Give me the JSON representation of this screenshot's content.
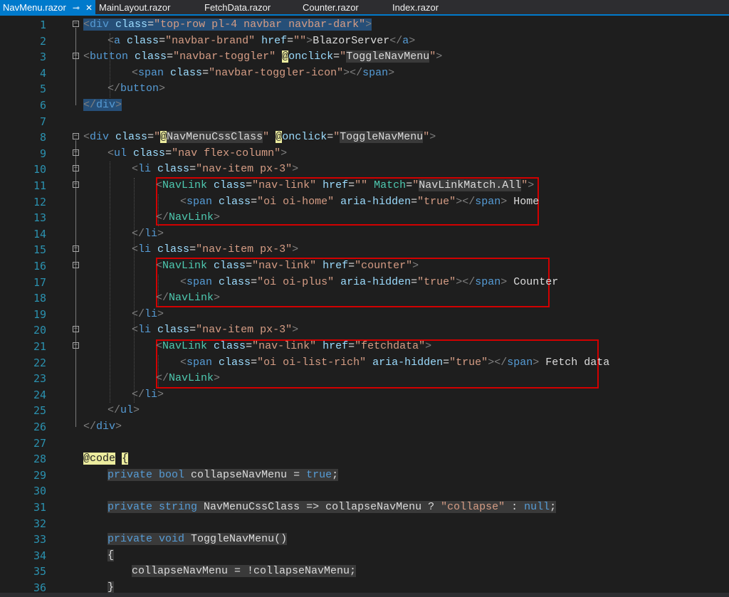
{
  "tabs": [
    {
      "label": "NavMenu.razor",
      "active": true,
      "pin": "⊸",
      "close": "✕"
    },
    {
      "label": "MainLayout.razor",
      "active": false
    },
    {
      "label": "FetchData.razor",
      "active": false
    },
    {
      "label": "Counter.razor",
      "active": false
    },
    {
      "label": "Index.razor",
      "active": false
    }
  ],
  "colors": {
    "accent": "#007acc",
    "highlight_box": "#d20000",
    "selection": "#264f78"
  },
  "lines": [
    {
      "n": "1",
      "fold": "minus",
      "tokens": [
        [
          "sel t-tag",
          "<"
        ],
        [
          "sel t-name",
          "div"
        ],
        [
          "sel t-text",
          " "
        ],
        [
          "sel t-attr",
          "class"
        ],
        [
          "sel t-text",
          "="
        ],
        [
          "sel t-val",
          "\"top-row pl-4 navbar navbar-dark\""
        ],
        [
          "sel t-tag",
          ">"
        ]
      ]
    },
    {
      "n": "2",
      "tokens": [
        [
          "t-tag",
          "<"
        ],
        [
          "t-name",
          "a"
        ],
        [
          "t-text",
          " "
        ],
        [
          "t-attr",
          "class"
        ],
        [
          "t-text",
          "="
        ],
        [
          "t-val",
          "\"navbar-brand\""
        ],
        [
          "t-text",
          " "
        ],
        [
          "t-attr",
          "href"
        ],
        [
          "t-text",
          "="
        ],
        [
          "t-val",
          "\"\""
        ],
        [
          "t-tag",
          ">"
        ],
        [
          "t-text",
          "BlazorServer"
        ],
        [
          "t-tag",
          "</"
        ],
        [
          "t-name",
          "a"
        ],
        [
          "t-tag",
          ">"
        ]
      ]
    },
    {
      "n": "3",
      "fold": "minus",
      "tokens": [
        [
          "t-tag",
          "<"
        ],
        [
          "t-name",
          "button"
        ],
        [
          "t-text",
          " "
        ],
        [
          "t-attr",
          "class"
        ],
        [
          "t-text",
          "="
        ],
        [
          "t-val",
          "\"navbar-toggler\""
        ],
        [
          "t-text",
          " "
        ],
        [
          "t-razor",
          "@"
        ],
        [
          "t-attr",
          "onclick"
        ],
        [
          "t-text",
          "="
        ],
        [
          "t-val",
          "\""
        ],
        [
          "hl-ws t-plain",
          "ToggleNavMenu"
        ],
        [
          "t-val",
          "\""
        ],
        [
          "t-tag",
          ">"
        ]
      ]
    },
    {
      "n": "4",
      "tokens": [
        [
          "t-tag",
          "<"
        ],
        [
          "t-name",
          "span"
        ],
        [
          "t-text",
          " "
        ],
        [
          "t-attr",
          "class"
        ],
        [
          "t-text",
          "="
        ],
        [
          "t-val",
          "\"navbar-toggler-icon\""
        ],
        [
          "t-tag",
          "></"
        ],
        [
          "t-name",
          "span"
        ],
        [
          "t-tag",
          ">"
        ]
      ]
    },
    {
      "n": "5",
      "tokens": [
        [
          "t-tag",
          "</"
        ],
        [
          "t-name",
          "button"
        ],
        [
          "t-tag",
          ">"
        ]
      ]
    },
    {
      "n": "6",
      "tokens": [
        [
          "sel t-tag",
          "</"
        ],
        [
          "sel t-name",
          "div"
        ],
        [
          "sel t-tag",
          ">"
        ]
      ]
    },
    {
      "n": "7",
      "tokens": []
    },
    {
      "n": "8",
      "fold": "minus",
      "tokens": [
        [
          "t-tag",
          "<"
        ],
        [
          "t-name",
          "div"
        ],
        [
          "t-text",
          " "
        ],
        [
          "t-attr",
          "class"
        ],
        [
          "t-text",
          "="
        ],
        [
          "t-val",
          "\""
        ],
        [
          "t-razor",
          "@"
        ],
        [
          "hl-ws t-plain",
          "NavMenuCssClass"
        ],
        [
          "t-val",
          "\""
        ],
        [
          "t-text",
          " "
        ],
        [
          "t-razor",
          "@"
        ],
        [
          "t-attr",
          "onclick"
        ],
        [
          "t-text",
          "="
        ],
        [
          "t-val",
          "\""
        ],
        [
          "hl-ws t-plain",
          "ToggleNavMenu"
        ],
        [
          "t-val",
          "\""
        ],
        [
          "t-tag",
          ">"
        ]
      ]
    },
    {
      "n": "9",
      "fold": "minus",
      "tokens": [
        [
          "t-tag",
          "<"
        ],
        [
          "t-name",
          "ul"
        ],
        [
          "t-text",
          " "
        ],
        [
          "t-attr",
          "class"
        ],
        [
          "t-text",
          "="
        ],
        [
          "t-val",
          "\"nav flex-column\""
        ],
        [
          "t-tag",
          ">"
        ]
      ]
    },
    {
      "n": "10",
      "fold": "minus",
      "tokens": [
        [
          "t-tag",
          "<"
        ],
        [
          "t-name",
          "li"
        ],
        [
          "t-text",
          " "
        ],
        [
          "t-attr",
          "class"
        ],
        [
          "t-text",
          "="
        ],
        [
          "t-val",
          "\"nav-item px-3\""
        ],
        [
          "t-tag",
          ">"
        ]
      ]
    },
    {
      "n": "11",
      "fold": "minus",
      "tokens": [
        [
          "t-tag",
          "<"
        ],
        [
          "t-comp",
          "NavLink"
        ],
        [
          "t-text",
          " "
        ],
        [
          "t-attr",
          "class"
        ],
        [
          "t-text",
          "="
        ],
        [
          "t-val",
          "\"nav-link\""
        ],
        [
          "t-text",
          " "
        ],
        [
          "t-attr",
          "href"
        ],
        [
          "t-text",
          "="
        ],
        [
          "t-val",
          "\"\""
        ],
        [
          "t-text",
          " "
        ],
        [
          "t-comp",
          "Match"
        ],
        [
          "t-text",
          "="
        ],
        [
          "t-val",
          "\""
        ],
        [
          "hl-ws t-plain",
          "NavLinkMatch.All"
        ],
        [
          "t-val",
          "\""
        ],
        [
          "t-tag",
          ">"
        ]
      ]
    },
    {
      "n": "12",
      "tokens": [
        [
          "t-tag",
          "<"
        ],
        [
          "t-name",
          "span"
        ],
        [
          "t-text",
          " "
        ],
        [
          "t-attr",
          "class"
        ],
        [
          "t-text",
          "="
        ],
        [
          "t-val",
          "\"oi oi-home\""
        ],
        [
          "t-text",
          " "
        ],
        [
          "t-attr",
          "aria-hidden"
        ],
        [
          "t-text",
          "="
        ],
        [
          "t-val",
          "\"true\""
        ],
        [
          "t-tag",
          "></"
        ],
        [
          "t-name",
          "span"
        ],
        [
          "t-tag",
          ">"
        ],
        [
          "t-text",
          " Home"
        ]
      ]
    },
    {
      "n": "13",
      "tokens": [
        [
          "t-tag",
          "</"
        ],
        [
          "t-comp",
          "NavLink"
        ],
        [
          "t-tag",
          ">"
        ]
      ]
    },
    {
      "n": "14",
      "tokens": [
        [
          "t-tag",
          "</"
        ],
        [
          "t-name",
          "li"
        ],
        [
          "t-tag",
          ">"
        ]
      ]
    },
    {
      "n": "15",
      "fold": "minus",
      "tokens": [
        [
          "t-tag",
          "<"
        ],
        [
          "t-name",
          "li"
        ],
        [
          "t-text",
          " "
        ],
        [
          "t-attr",
          "class"
        ],
        [
          "t-text",
          "="
        ],
        [
          "t-val",
          "\"nav-item px-3\""
        ],
        [
          "t-tag",
          ">"
        ]
      ]
    },
    {
      "n": "16",
      "fold": "minus",
      "tokens": [
        [
          "t-tag",
          "<"
        ],
        [
          "t-comp",
          "NavLink"
        ],
        [
          "t-text",
          " "
        ],
        [
          "t-attr",
          "class"
        ],
        [
          "t-text",
          "="
        ],
        [
          "t-val",
          "\"nav-link\""
        ],
        [
          "t-text",
          " "
        ],
        [
          "t-attr",
          "href"
        ],
        [
          "t-text",
          "="
        ],
        [
          "t-val",
          "\"counter\""
        ],
        [
          "t-tag",
          ">"
        ]
      ]
    },
    {
      "n": "17",
      "tokens": [
        [
          "t-tag",
          "<"
        ],
        [
          "t-name",
          "span"
        ],
        [
          "t-text",
          " "
        ],
        [
          "t-attr",
          "class"
        ],
        [
          "t-text",
          "="
        ],
        [
          "t-val",
          "\"oi oi-plus\""
        ],
        [
          "t-text",
          " "
        ],
        [
          "t-attr",
          "aria-hidden"
        ],
        [
          "t-text",
          "="
        ],
        [
          "t-val",
          "\"true\""
        ],
        [
          "t-tag",
          "></"
        ],
        [
          "t-name",
          "span"
        ],
        [
          "t-tag",
          ">"
        ],
        [
          "t-text",
          " Counter"
        ]
      ]
    },
    {
      "n": "18",
      "tokens": [
        [
          "t-tag",
          "</"
        ],
        [
          "t-comp",
          "NavLink"
        ],
        [
          "t-tag",
          ">"
        ]
      ]
    },
    {
      "n": "19",
      "tokens": [
        [
          "t-tag",
          "</"
        ],
        [
          "t-name",
          "li"
        ],
        [
          "t-tag",
          ">"
        ]
      ]
    },
    {
      "n": "20",
      "fold": "minus",
      "tokens": [
        [
          "t-tag",
          "<"
        ],
        [
          "t-name",
          "li"
        ],
        [
          "t-text",
          " "
        ],
        [
          "t-attr",
          "class"
        ],
        [
          "t-text",
          "="
        ],
        [
          "t-val",
          "\"nav-item px-3\""
        ],
        [
          "t-tag",
          ">"
        ]
      ]
    },
    {
      "n": "21",
      "fold": "minus",
      "tokens": [
        [
          "t-tag",
          "<"
        ],
        [
          "t-comp",
          "NavLink"
        ],
        [
          "t-text",
          " "
        ],
        [
          "t-attr",
          "class"
        ],
        [
          "t-text",
          "="
        ],
        [
          "t-val",
          "\"nav-link\""
        ],
        [
          "t-text",
          " "
        ],
        [
          "t-attr",
          "href"
        ],
        [
          "t-text",
          "="
        ],
        [
          "t-val",
          "\"fetchdata\""
        ],
        [
          "t-tag",
          ">"
        ]
      ]
    },
    {
      "n": "22",
      "tokens": [
        [
          "t-tag",
          "<"
        ],
        [
          "t-name",
          "span"
        ],
        [
          "t-text",
          " "
        ],
        [
          "t-attr",
          "class"
        ],
        [
          "t-text",
          "="
        ],
        [
          "t-val",
          "\"oi oi-list-rich\""
        ],
        [
          "t-text",
          " "
        ],
        [
          "t-attr",
          "aria-hidden"
        ],
        [
          "t-text",
          "="
        ],
        [
          "t-val",
          "\"true\""
        ],
        [
          "t-tag",
          "></"
        ],
        [
          "t-name",
          "span"
        ],
        [
          "t-tag",
          ">"
        ],
        [
          "t-text",
          " Fetch data"
        ]
      ]
    },
    {
      "n": "23",
      "tokens": [
        [
          "t-tag",
          "</"
        ],
        [
          "t-comp",
          "NavLink"
        ],
        [
          "t-tag",
          ">"
        ]
      ]
    },
    {
      "n": "24",
      "tokens": [
        [
          "t-tag",
          "</"
        ],
        [
          "t-name",
          "li"
        ],
        [
          "t-tag",
          ">"
        ]
      ]
    },
    {
      "n": "25",
      "tokens": [
        [
          "t-tag",
          "</"
        ],
        [
          "t-name",
          "ul"
        ],
        [
          "t-tag",
          ">"
        ]
      ]
    },
    {
      "n": "26",
      "tokens": [
        [
          "t-tag",
          "</"
        ],
        [
          "t-name",
          "div"
        ],
        [
          "t-tag",
          ">"
        ]
      ]
    },
    {
      "n": "27",
      "tokens": []
    },
    {
      "n": "28",
      "tokens": [
        [
          "t-razor",
          "@code"
        ],
        [
          "t-plain",
          " "
        ],
        [
          "t-razor",
          "{"
        ]
      ]
    },
    {
      "n": "29",
      "tokens": [
        [
          "hl-ws t-kw",
          "private"
        ],
        [
          "hl-ws t-plain",
          " "
        ],
        [
          "hl-ws t-kw",
          "bool"
        ],
        [
          "hl-ws t-plain",
          " collapseNavMenu = "
        ],
        [
          "hl-ws t-kw",
          "true"
        ],
        [
          "hl-ws t-plain",
          ";"
        ]
      ]
    },
    {
      "n": "30",
      "tokens": []
    },
    {
      "n": "31",
      "tokens": [
        [
          "hl-ws t-kw",
          "private"
        ],
        [
          "hl-ws t-plain",
          " "
        ],
        [
          "hl-ws t-kw",
          "string"
        ],
        [
          "hl-ws t-plain",
          " NavMenuCssClass => collapseNavMenu ? "
        ],
        [
          "hl-ws t-str",
          "\"collapse\""
        ],
        [
          "hl-ws t-plain",
          " : "
        ],
        [
          "hl-ws t-kw",
          "null"
        ],
        [
          "hl-ws t-plain",
          ";"
        ]
      ]
    },
    {
      "n": "32",
      "tokens": []
    },
    {
      "n": "33",
      "tokens": [
        [
          "hl-ws t-kw",
          "private"
        ],
        [
          "hl-ws t-plain",
          " "
        ],
        [
          "hl-ws t-kw",
          "void"
        ],
        [
          "hl-ws t-plain",
          " ToggleNavMenu()"
        ]
      ]
    },
    {
      "n": "34",
      "tokens": [
        [
          "hl-ws t-plain",
          "{"
        ]
      ]
    },
    {
      "n": "35",
      "tokens": [
        [
          "hl-ws t-plain",
          "collapseNavMenu = !collapseNavMenu;"
        ]
      ]
    },
    {
      "n": "36",
      "tokens": [
        [
          "hl-ws t-plain",
          "}"
        ]
      ]
    }
  ]
}
